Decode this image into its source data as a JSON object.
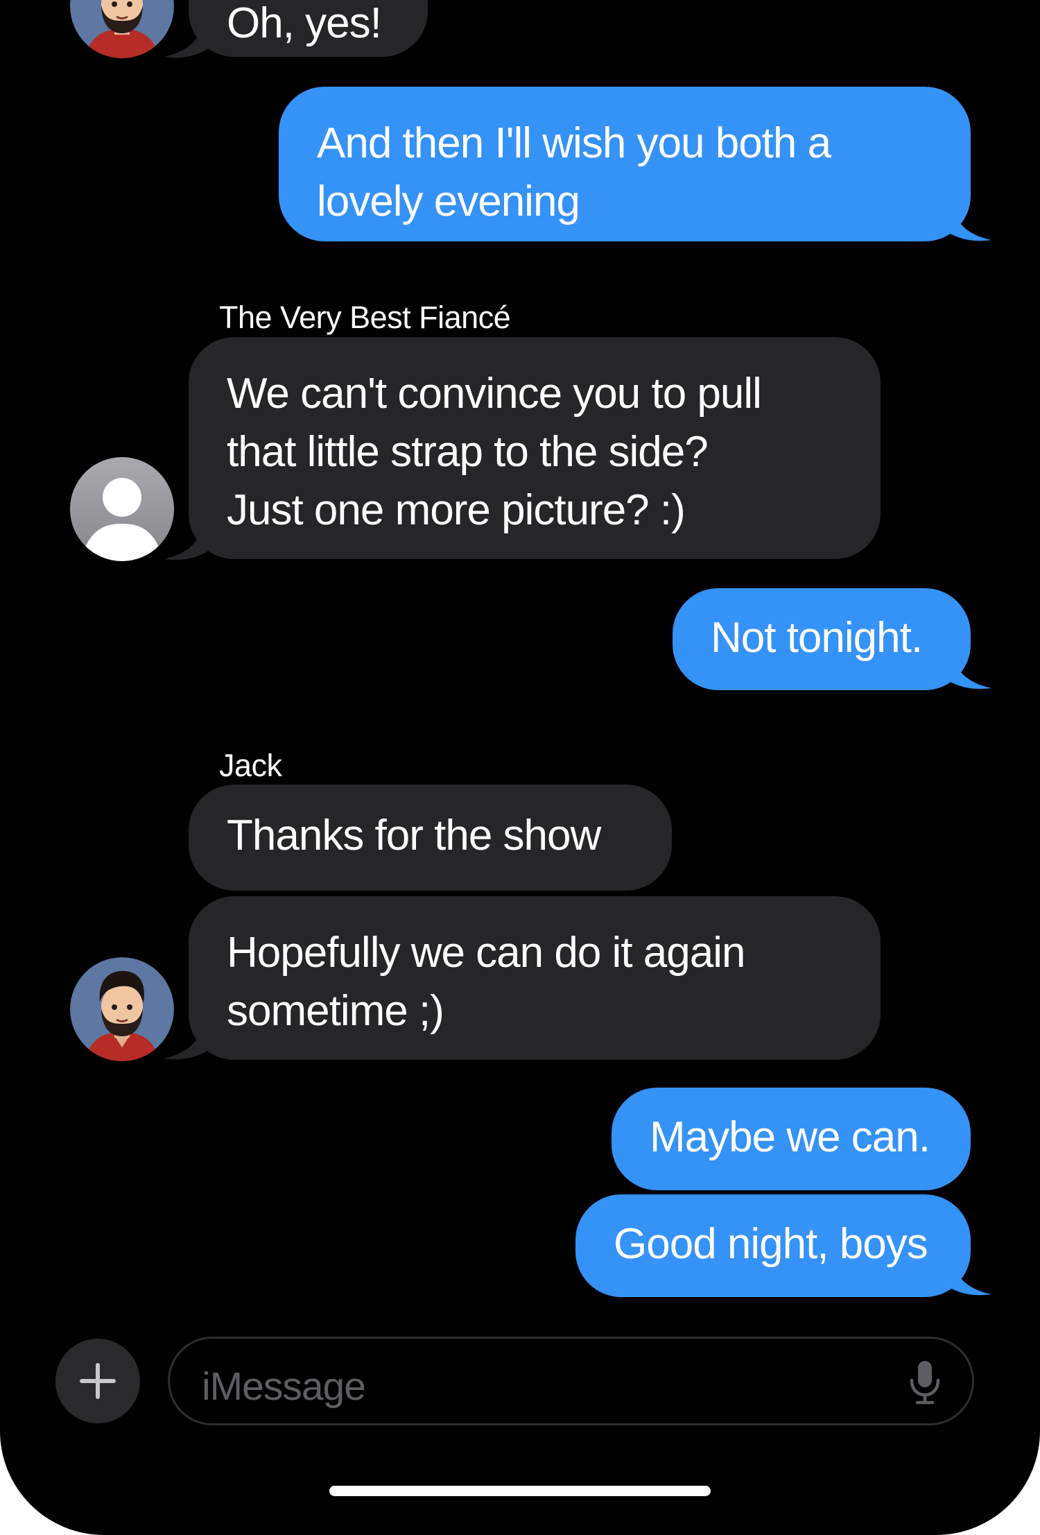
{
  "conversation": {
    "messages": [
      {
        "sender": "",
        "text": "Oh, yes!",
        "direction": "incoming"
      },
      {
        "sender": "",
        "text": "And then I'll wish you both a\nlovely evening",
        "direction": "outgoing"
      },
      {
        "sender": "The Very Best Fiancé",
        "text": "We can't convince you to pull\nthat little strap to the side?\nJust one more picture? :)",
        "direction": "incoming"
      },
      {
        "sender": "",
        "text": "Not tonight.",
        "direction": "outgoing"
      },
      {
        "sender": "Jack",
        "text": "Thanks for the show",
        "direction": "incoming"
      },
      {
        "sender": "",
        "text": "Hopefully we can do it again\nsometime ;)",
        "direction": "incoming"
      },
      {
        "sender": "",
        "text": "Maybe we can.",
        "direction": "outgoing"
      },
      {
        "sender": "",
        "text": "Good night, boys",
        "direction": "outgoing"
      }
    ]
  },
  "composer": {
    "placeholder": "iMessage",
    "add_icon": "plus-icon",
    "mic_icon": "microphone-icon"
  },
  "colors": {
    "background": "#000000",
    "incoming_bubble": "#262629",
    "outgoing_bubble": "#3592f7",
    "text": "#ffffff",
    "placeholder": "#5d5d62"
  }
}
